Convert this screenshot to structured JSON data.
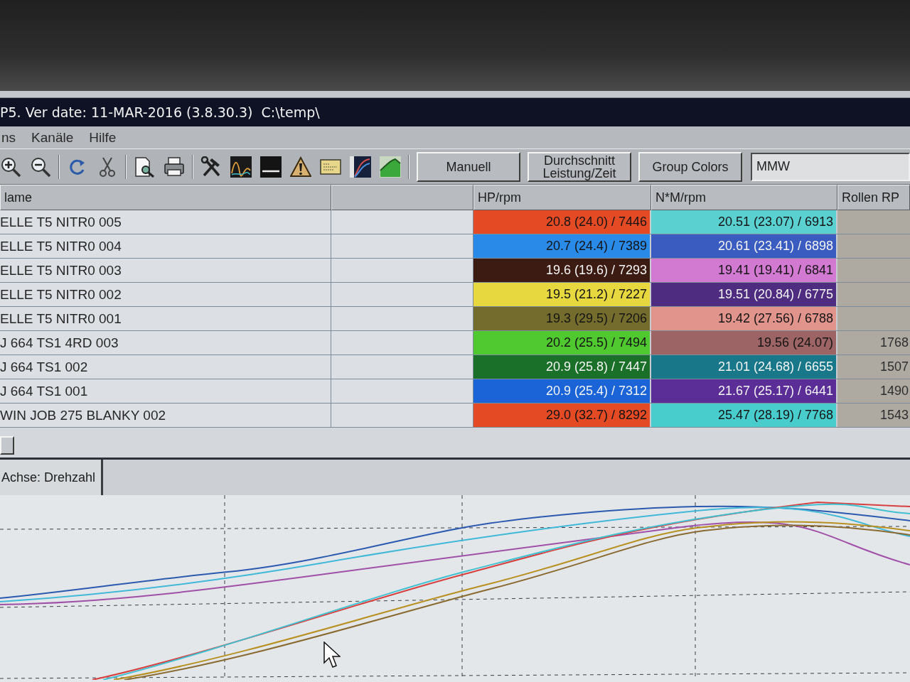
{
  "window": {
    "title": "P5. Ver date: 11-MAR-2016 (3.8.30.3)  C:\\temp\\"
  },
  "menu": [
    {
      "label": "ns"
    },
    {
      "label": "Kanäle"
    },
    {
      "label": "Hilfe"
    }
  ],
  "toolbar": {
    "buttons": [
      {
        "label": "Manuell"
      },
      {
        "label": "Durchschnitt Leistung/Zeit"
      },
      {
        "label": "Group Colors"
      }
    ],
    "field": {
      "value": "MMW"
    }
  },
  "table": {
    "columns": [
      {
        "label": "lame"
      },
      {
        "label": "HP/rpm"
      },
      {
        "label": "N*M/rpm"
      },
      {
        "label": "Rollen RP"
      }
    ],
    "rows": [
      {
        "name": "ELLE T5 NITR0 005",
        "hp": {
          "text": "20.8 (24.0) / 7446",
          "color": "#e44a24"
        },
        "nm": {
          "text": "20.51 (23.07) / 6913",
          "color": "#5ad0d0"
        }
      },
      {
        "name": "ELLE T5 NITR0 004",
        "hp": {
          "text": "20.7 (24.4) / 7389",
          "color": "#2a8ae8"
        },
        "nm": {
          "text": "20.61 (23.41) / 6898",
          "color": "#3a5cc0"
        }
      },
      {
        "name": "ELLE T5 NITR0 003",
        "hp": {
          "text": "19.6 (19.6) / 7293",
          "color": "#3c1c12"
        },
        "nm": {
          "text": "19.41 (19.41) / 6841",
          "color": "#d27ad2"
        }
      },
      {
        "name": "ELLE T5 NITR0 002",
        "hp": {
          "text": "19.5 (21.2) / 7227",
          "color": "#e8d840"
        },
        "nm": {
          "text": "19.51 (20.84) / 6775",
          "color": "#4e2c80"
        }
      },
      {
        "name": "ELLE T5 NITR0 001",
        "hp": {
          "text": "19.3 (29.5) / 7206",
          "color": "#746c2c"
        },
        "nm": {
          "text": "19.42 (27.56) / 6788",
          "color": "#e0948c"
        }
      },
      {
        "name": "J 664 TS1 4RD 003",
        "hp": {
          "text": "20.2 (25.5) / 7494",
          "color": "#50c830"
        },
        "nm": {
          "text": "19.56 (24.07)",
          "color": "#9c6464"
        },
        "rollen": "1768"
      },
      {
        "name": "J 664 TS1 002",
        "hp": {
          "text": "20.9 (25.8) / 7447",
          "color": "#1a7028"
        },
        "nm": {
          "text": "21.01 (24.68) / 6655",
          "color": "#18788a"
        },
        "rollen": "1507"
      },
      {
        "name": "J 664 TS1 001",
        "hp": {
          "text": "20.9 (25.4) / 7312",
          "color": "#1a64d8"
        },
        "nm": {
          "text": "21.67 (25.17) / 6441",
          "color": "#5a2e96"
        },
        "rollen": "1490"
      },
      {
        "name": "WIN JOB 275 BLANKY 002",
        "hp": {
          "text": "29.0 (32.7) / 8292",
          "color": "#e44a24"
        },
        "nm": {
          "text": "25.47 (28.19) / 7768",
          "color": "#48cccc"
        },
        "rollen": "1543"
      }
    ]
  },
  "axis_tab": {
    "label": "Achse: Drehzahl"
  }
}
